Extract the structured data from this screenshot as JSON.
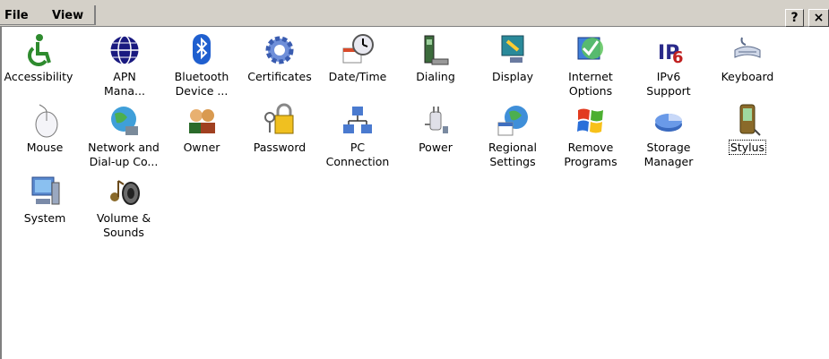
{
  "menu": {
    "file_label": "File",
    "view_label": "View",
    "help_label": "?",
    "close_label": "×"
  },
  "applets": [
    {
      "label": "Accessibility"
    },
    {
      "label": "APN\nMana..."
    },
    {
      "label": "Bluetooth\nDevice ..."
    },
    {
      "label": "Certificates"
    },
    {
      "label": "Date/Time"
    },
    {
      "label": "Dialing"
    },
    {
      "label": "Display"
    },
    {
      "label": "Internet\nOptions"
    },
    {
      "label": "IPv6\nSupport"
    },
    {
      "label": "Keyboard"
    },
    {
      "label": "Mouse"
    },
    {
      "label": "Network and\nDial-up Co..."
    },
    {
      "label": "Owner"
    },
    {
      "label": "Password"
    },
    {
      "label": "PC\nConnection"
    },
    {
      "label": "Power"
    },
    {
      "label": "Regional\nSettings"
    },
    {
      "label": "Remove\nPrograms"
    },
    {
      "label": "Storage\nManager"
    },
    {
      "label": "Stylus"
    },
    {
      "label": "System"
    },
    {
      "label": "Volume &\nSounds"
    }
  ]
}
